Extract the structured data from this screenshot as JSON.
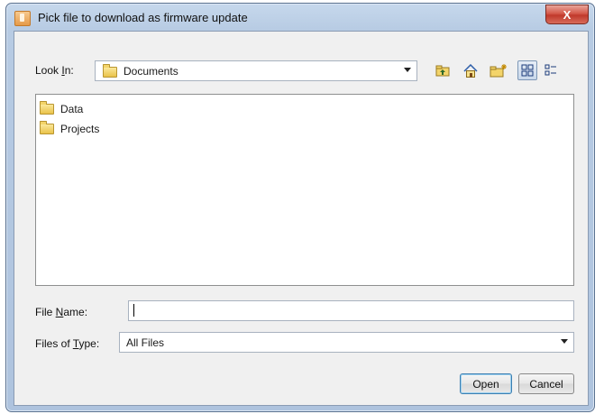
{
  "window": {
    "title": "Pick file to download as firmware update",
    "close_label": "X"
  },
  "look_in": {
    "label_pre": "Look ",
    "label_mnemonic": "I",
    "label_post": "n:",
    "value": "Documents"
  },
  "toolbar": {
    "icons": [
      "up-one-level-icon",
      "home-icon",
      "new-folder-icon",
      "list-view-icon",
      "details-view-icon"
    ]
  },
  "files": [
    {
      "name": "Data",
      "icon": "folder-icon"
    },
    {
      "name": "Projects",
      "icon": "folder-icon"
    }
  ],
  "file_name": {
    "label_pre": "File ",
    "label_mnemonic": "N",
    "label_post": "ame:",
    "value": ""
  },
  "files_of_type": {
    "label_pre": "Files of ",
    "label_mnemonic": "T",
    "label_post": "ype:",
    "value": "All Files"
  },
  "buttons": {
    "open": "Open",
    "cancel": "Cancel"
  }
}
